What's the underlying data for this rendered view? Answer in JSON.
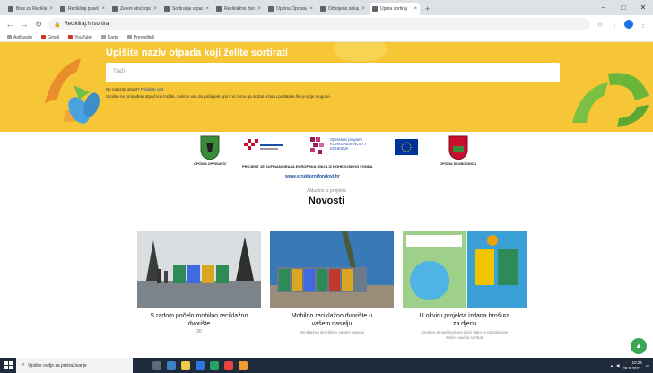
{
  "browser": {
    "tabs": [
      {
        "label": "Boje za Reciklažu",
        "active": false
      },
      {
        "label": "Recikliraj pravilno",
        "active": false
      },
      {
        "label": "Zeleni otoci općina",
        "active": false
      },
      {
        "label": "Sortiranje otpada",
        "active": false
      },
      {
        "label": "Reciklažno dvorište",
        "active": false
      },
      {
        "label": "Općina Oprisavci",
        "active": false
      },
      {
        "label": "Odvojeno sakupljanje",
        "active": false
      },
      {
        "label": "Uputa sortiraj",
        "active": true
      }
    ],
    "url": "Recikliraj.hr/sortiraj",
    "bookmarks": [
      "Aplikacije",
      "Gmail",
      "YouTube",
      "Karte",
      "Prevoditelj"
    ]
  },
  "hero": {
    "title": "Upišite naziv otpada koji želite sortirati",
    "search_placeholder": "Traži",
    "link_prefix": "Ne nalazite otpad? ",
    "link_text": "Pošaljite upit",
    "note": "Ukoliko ne pronađete otpad koji tražite, molimo vas da pošaljete upit i mi ćemo ga dodati u bazu podataka što je prije moguće."
  },
  "partners": {
    "municipality_left": "OPĆINA OPRISAVCI",
    "operational_programme": "Operativni program KONKURENTNOST I KOHEZIJA",
    "eu_bar": "PROJEKT JE SUFINANCIRALA EUROPSKA UNIJA IZ KOHEZIJSKOG FONDA",
    "municipality_right": "OPĆINA SLOBODNICA",
    "website": "www.strukturnifondovi.hr"
  },
  "news": {
    "kicker": "Aktualno iz projekta",
    "title": "Novosti",
    "cards": [
      {
        "title": "S radom počelo mobilno reciklažno dvorište",
        "excerpt": "",
        "date": "20"
      },
      {
        "title": "Mobilno reciklažno dvorište u vašem naselju",
        "excerpt": "Reciklažno dvorište u vašem naselju",
        "date": ""
      },
      {
        "title": "U okviru projekta izdana brošura za djecu",
        "excerpt": "Brošura je namijenjena djeci kako bi na zabavan način naučila sortirati",
        "date": ""
      }
    ]
  },
  "taskbar": {
    "search_placeholder": "Upišite ovdje za pretraživanje",
    "time": "10:24",
    "date": "28.5.2021."
  },
  "colors": {
    "hero_bg": "#f6c636",
    "accent_green": "#3aa655",
    "taskbar": "#1f2a3a"
  }
}
